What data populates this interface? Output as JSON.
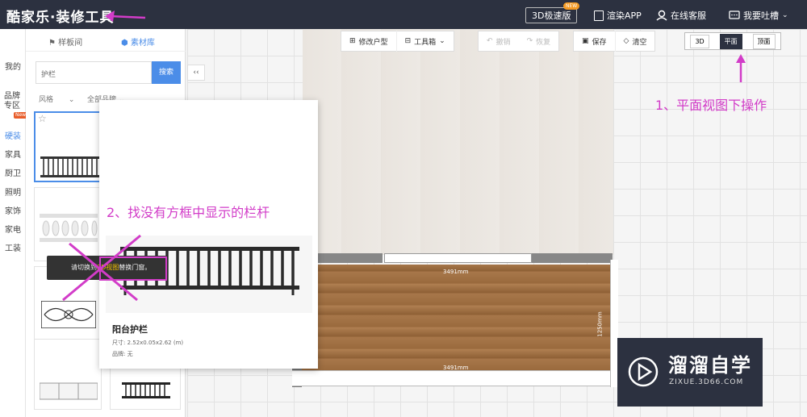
{
  "header": {
    "logo": "酷家乐·装修工具",
    "speed_label": "3D极速版",
    "speed_badge": "NEW",
    "render_app": "渲染APP",
    "online_service": "在线客服",
    "feedback": "我要吐槽"
  },
  "leftnav": {
    "items": [
      {
        "label": "我的"
      },
      {
        "label": "品牌专区",
        "badge": "New"
      },
      {
        "label": "硬装",
        "active": true
      },
      {
        "label": "家具"
      },
      {
        "label": "厨卫"
      },
      {
        "label": "照明"
      },
      {
        "label": "家饰"
      },
      {
        "label": "家电"
      },
      {
        "label": "工装"
      }
    ]
  },
  "panel": {
    "tab_showroom": "样板间",
    "tab_library": "素材库",
    "search_value": "护栏",
    "search_button": "搜索",
    "filter_style": "风格",
    "filter_brand": "全部品牌",
    "collapse_label": "‹‹"
  },
  "toolbar": {
    "modify_layout": "修改户型",
    "toolbox": "工具箱",
    "undo": "撤销",
    "redo": "恢复",
    "save": "保存",
    "clear": "清空"
  },
  "view_toggle": {
    "options": [
      "3D",
      "平面",
      "顶面"
    ],
    "active": "平面"
  },
  "canvas": {
    "dim_top": "3491mm",
    "dim_bottom": "3491mm",
    "dim_side": "1250mm"
  },
  "popup": {
    "title": "阳台护栏",
    "size": "尺寸: 2.52x0.05x2.62 (m)",
    "brand": "品牌: 无",
    "toast_pre": "请切换到",
    "toast_hl": "3D视图",
    "toast_post": "替换门窗。"
  },
  "annotations": {
    "step1": "1、平面视图下操作",
    "step2": "2、找没有方框中显示的栏杆"
  },
  "watermark": {
    "title": "溜溜自学",
    "url": "ZIXUE.3D66.COM"
  },
  "colors": {
    "header_bg": "#2c3140",
    "accent": "#4b8de8",
    "annotation": "#d23cc8",
    "badge": "#f59a23"
  }
}
